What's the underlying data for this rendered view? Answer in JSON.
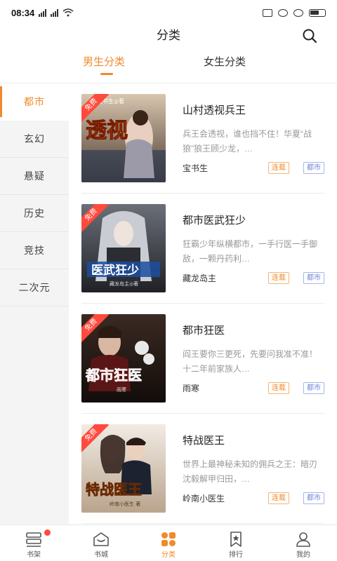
{
  "status_bar": {
    "time": "08:34"
  },
  "header": {
    "title": "分类"
  },
  "tabs": [
    {
      "label": "男生分类",
      "active": true
    },
    {
      "label": "女生分类",
      "active": false
    }
  ],
  "sidebar": {
    "items": [
      {
        "label": "都市",
        "active": true
      },
      {
        "label": "玄幻"
      },
      {
        "label": "悬疑"
      },
      {
        "label": "历史"
      },
      {
        "label": "竞技"
      },
      {
        "label": "二次元"
      }
    ]
  },
  "books": [
    {
      "title": "山村透视兵王",
      "description": "兵王会透视，谁也挡不住！华夏“战狼”狼王顾少龙，…",
      "author": "宝书生",
      "status": "连载",
      "category": "都市",
      "badge": "免费",
      "cover_text": "透视",
      "cover_author": "宝书生◎著"
    },
    {
      "title": "都市医武狂少",
      "description": "狂霸少年纵横都市，一手行医一手御敌，一颗丹药利…",
      "author": "藏龙岛主",
      "status": "连载",
      "category": "都市",
      "badge": "免费",
      "cover_text": "医武狂少",
      "cover_author": "藏龙岛主◎著"
    },
    {
      "title": "都市狂医",
      "description": "阎王要你三更死，先要问我准不准！十二年前家族人…",
      "author": "雨寒",
      "status": "连载",
      "category": "都市",
      "badge": "免费",
      "cover_text": "都市狂医",
      "cover_author": "雨寒"
    },
    {
      "title": "特战医王",
      "description": "世界上最神秘未知的佣兵之王：暗刃沈毅解甲归田，…",
      "author": "岭南小医生",
      "status": "连载",
      "category": "都市",
      "badge": "免费",
      "cover_text": "特战医王",
      "cover_author": "岭南小医生 著"
    }
  ],
  "bottom_nav": [
    {
      "label": "书架",
      "icon": "bookshelf-icon",
      "badge_dot": true
    },
    {
      "label": "书城",
      "icon": "bookstore-icon"
    },
    {
      "label": "分类",
      "icon": "category-icon",
      "active": true
    },
    {
      "label": "排行",
      "icon": "ranking-icon"
    },
    {
      "label": "我的",
      "icon": "profile-icon"
    }
  ],
  "colors": {
    "accent": "#f08a2c",
    "tag_blue": "#6d86d6",
    "badge_red": "#ff4a3d"
  }
}
